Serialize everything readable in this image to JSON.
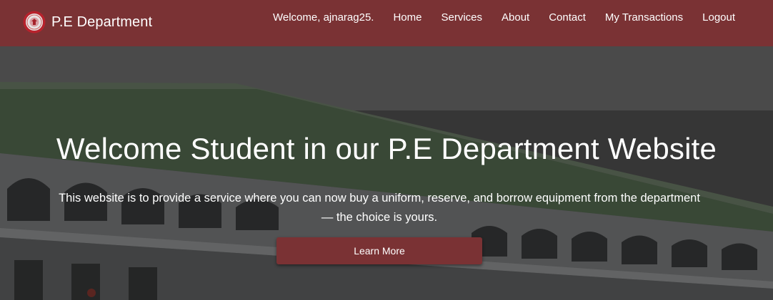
{
  "navbar": {
    "brand": "P.E Department",
    "logo_icon": "university-seal-logo",
    "welcome": "Welcome, ajnarag25.",
    "links": [
      "Home",
      "Services",
      "About",
      "Contact",
      "My Transactions",
      "Logout"
    ]
  },
  "hero": {
    "title": "Welcome Student in our P.E Department Website",
    "subtitle_line1": "This website is to provide a service where you can now buy a uniform, reserve, and borrow equipment from the department",
    "subtitle_line2": "— the choice is yours.",
    "button_label": "Learn More",
    "background": "school-building-photo"
  },
  "colors": {
    "brand": "#7a3234",
    "text": "#ffffff"
  }
}
